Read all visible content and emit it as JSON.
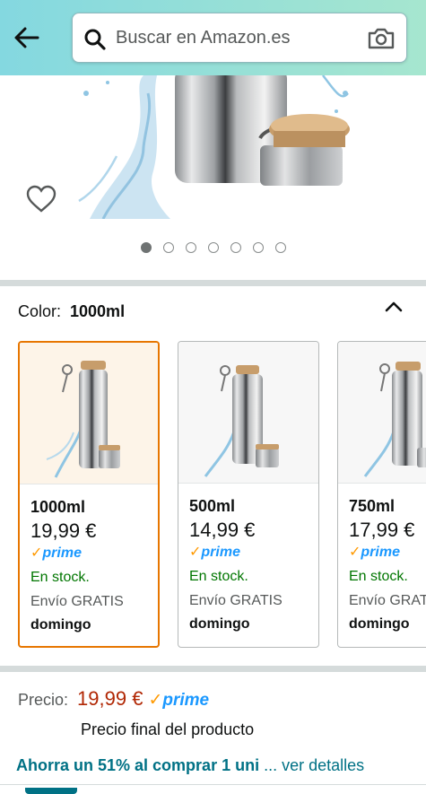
{
  "search": {
    "placeholder": "Buscar en Amazon.es",
    "value": ""
  },
  "carousel": {
    "count": 7,
    "active_index": 0
  },
  "color": {
    "label": "Color:",
    "selected": "1000ml"
  },
  "variants": [
    {
      "size": "1000ml",
      "price": "19,99 €",
      "prime": "prime",
      "stock": "En stock.",
      "shipping": "Envío GRATIS",
      "day": "domingo",
      "selected": true
    },
    {
      "size": "500ml",
      "price": "14,99 €",
      "prime": "prime",
      "stock": "En stock.",
      "shipping": "Envío GRATIS",
      "day": "domingo",
      "selected": false
    },
    {
      "size": "750ml",
      "price": "17,99 €",
      "prime": "prime",
      "stock": "En stock.",
      "shipping": "Envío GRATIS",
      "day": "domingo",
      "selected": false
    }
  ],
  "price": {
    "label": "Precio:",
    "value": "19,99 €",
    "prime": "prime",
    "note": "Precio final del producto"
  },
  "savings": {
    "text": "Ahorra un 51% al comprar 1 uni",
    "link": "... ver detalles"
  },
  "colors": {
    "header_start": "#84d8e0",
    "header_end": "#a6e6cf",
    "price": "#b12704",
    "stock": "#007600",
    "prime": "#1a98ff",
    "link": "#007185",
    "selected_border": "#e77600"
  },
  "icons": {
    "back": "arrow-left-icon",
    "search": "search-icon",
    "camera": "camera-icon",
    "wishlist": "heart-icon",
    "collapse": "chevron-up-icon"
  }
}
